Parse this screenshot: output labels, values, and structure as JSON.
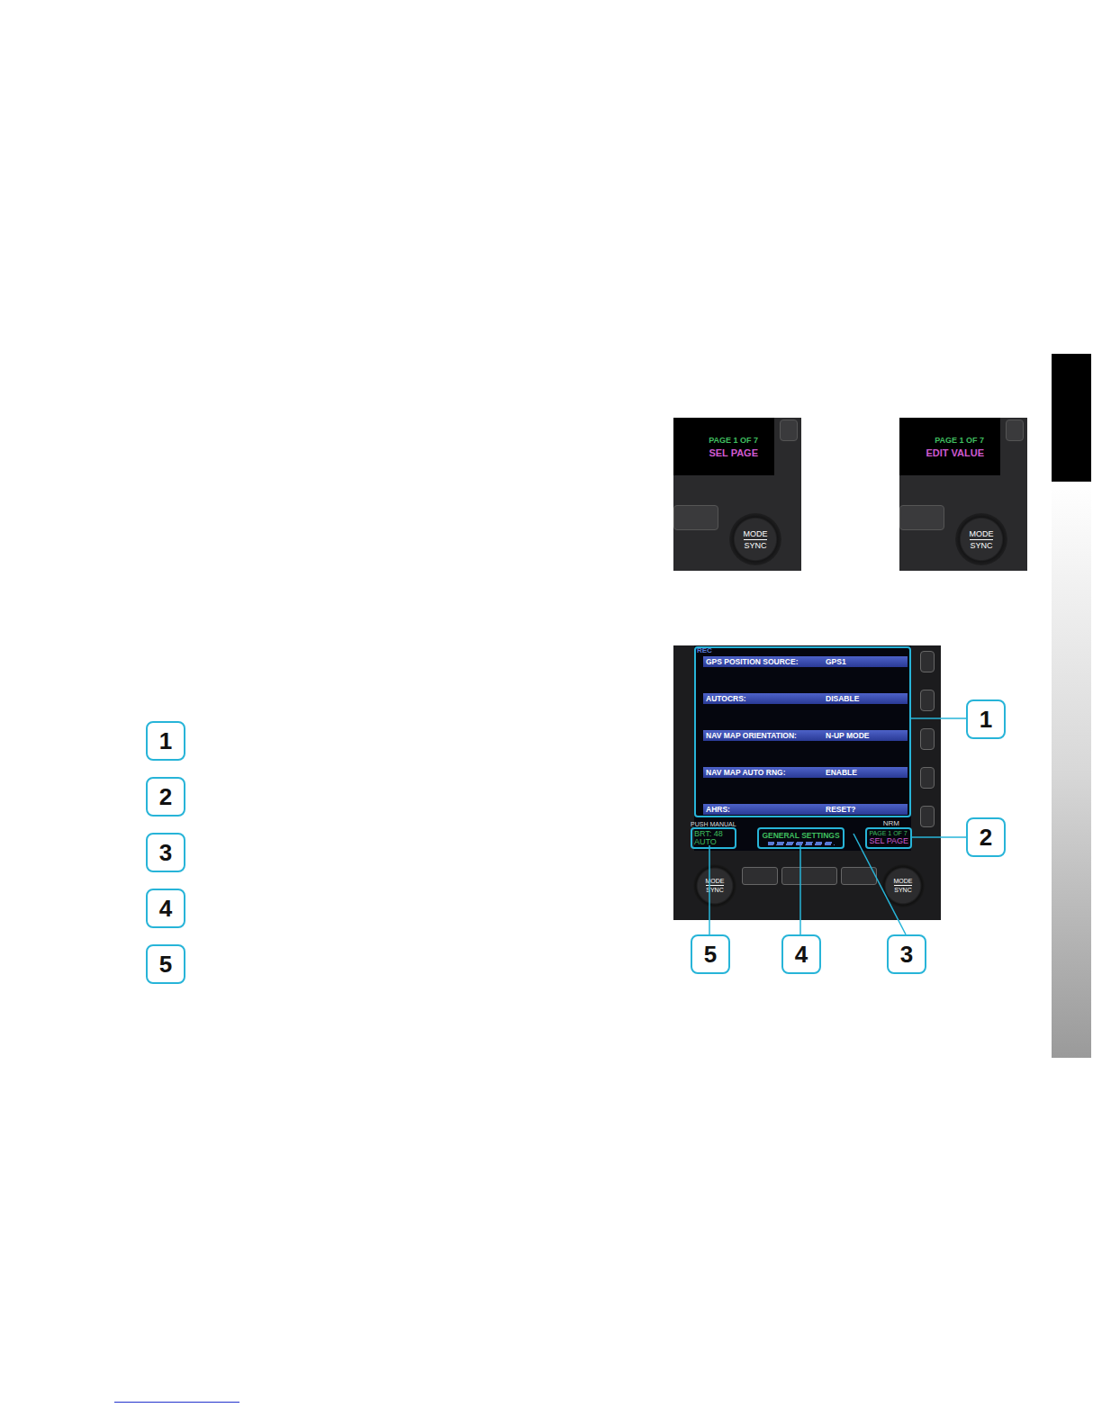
{
  "legend_badges": [
    "1",
    "2",
    "3",
    "4",
    "5"
  ],
  "mode_photos": [
    {
      "page": "PAGE 1 OF 7",
      "mode": "SEL PAGE",
      "knob_top": "MODE",
      "knob_bottom": "SYNC"
    },
    {
      "page": "PAGE 1 OF 7",
      "mode": "EDIT VALUE",
      "knob_top": "MODE",
      "knob_bottom": "SYNC"
    }
  ],
  "display": {
    "corner_labels": {
      "top_left": "REC",
      "status_right": "NRM"
    },
    "settings": [
      {
        "label": "GPS POSITION SOURCE:",
        "value": "GPS1"
      },
      {
        "label": "AUTOCRS:",
        "value": "DISABLE"
      },
      {
        "label": "NAV MAP ORIENTATION:",
        "value": "N-UP MODE"
      },
      {
        "label": "NAV MAP AUTO RNG:",
        "value": "ENABLE"
      },
      {
        "label": "AHRS:",
        "value": "RESET?"
      }
    ],
    "brightness": {
      "hint": "PUSH MANUAL",
      "reading": "BRT: 48",
      "mode": "AUTO"
    },
    "page_title": "GENERAL SETTINGS",
    "page_indicator": {
      "page": "PAGE 1 OF 7",
      "mode": "SEL PAGE"
    },
    "knobs": [
      {
        "top": "MODE",
        "bottom": "SYNC"
      },
      {
        "top": "MODE",
        "bottom": "SYNC"
      }
    ]
  },
  "callouts": [
    {
      "number": "1"
    },
    {
      "number": "2"
    },
    {
      "number": "3"
    },
    {
      "number": "4"
    },
    {
      "number": "5"
    }
  ]
}
